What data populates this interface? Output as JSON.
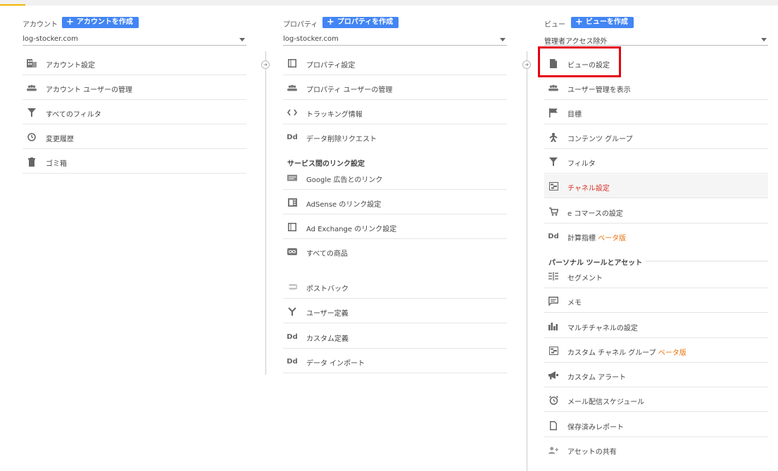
{
  "account": {
    "label": "アカウント",
    "create_label": "アカウントを作成",
    "selected": "log-stocker.com",
    "items": [
      {
        "label": "アカウント設定",
        "icon": "building-icon"
      },
      {
        "label": "アカウント ユーザーの管理",
        "icon": "people-icon"
      },
      {
        "label": "すべてのフィルタ",
        "icon": "filter-icon"
      },
      {
        "label": "変更履歴",
        "icon": "history-icon"
      },
      {
        "label": "ゴミ箱",
        "icon": "trash-icon"
      }
    ]
  },
  "property": {
    "label": "プロパティ",
    "create_label": "プロパティを作成",
    "selected": "log-stocker.com",
    "items": [
      {
        "label": "プロパティ設定",
        "icon": "square-icon"
      },
      {
        "label": "プロパティ ユーザーの管理",
        "icon": "people-icon"
      },
      {
        "label": "トラッキング情報",
        "icon": "code-icon"
      },
      {
        "label": "データ削除リクエスト",
        "icon": "dd-icon"
      }
    ],
    "link_section_title": "サービス間のリンク設定",
    "link_items": [
      {
        "label": "Google 広告とのリンク",
        "icon": "ads-icon"
      },
      {
        "label": "AdSense のリンク設定",
        "icon": "adsense-icon"
      },
      {
        "label": "Ad Exchange のリンク設定",
        "icon": "square-icon"
      },
      {
        "label": "すべての商品",
        "icon": "link-icon"
      }
    ],
    "other_items": [
      {
        "label": "ポストバック",
        "icon": "postback-icon"
      },
      {
        "label": "ユーザー定義",
        "icon": "fork-icon"
      },
      {
        "label": "カスタム定義",
        "icon": "dd-icon"
      },
      {
        "label": "データ インポート",
        "icon": "dd-icon"
      }
    ]
  },
  "view": {
    "label": "ビュー",
    "create_label": "ビューを作成",
    "selected": "管理者アクセス除外",
    "items": [
      {
        "label": "ビューの設定",
        "icon": "document-icon"
      },
      {
        "label": "ユーザー管理を表示",
        "icon": "people-icon"
      },
      {
        "label": "目標",
        "icon": "flag-icon"
      },
      {
        "label": "コンテンツ グループ",
        "icon": "person-walk-icon"
      },
      {
        "label": "フィルタ",
        "icon": "filter-icon"
      },
      {
        "label": "チャネル設定",
        "icon": "channel-icon"
      },
      {
        "label": "e コマースの設定",
        "icon": "cart-icon"
      },
      {
        "label": "計算指標",
        "beta": "ベータ版",
        "icon": "dd-icon"
      }
    ],
    "personal_section_title": "パーソナル ツールとアセット",
    "personal_items": [
      {
        "label": "セグメント",
        "icon": "segment-icon"
      },
      {
        "label": "メモ",
        "icon": "comment-icon"
      },
      {
        "label": "マルチチャネルの設定",
        "icon": "bar-chart-icon"
      },
      {
        "label": "カスタム チャネル グループ",
        "beta": "ベータ版",
        "icon": "channel-icon"
      },
      {
        "label": "カスタム アラート",
        "icon": "megaphone-icon"
      },
      {
        "label": "メール配信スケジュール",
        "icon": "alarm-icon"
      },
      {
        "label": "保存済みレポート",
        "icon": "file-icon"
      },
      {
        "label": "アセットの共有",
        "icon": "person-add-icon"
      }
    ]
  },
  "colors": {
    "accent_blue": "#4285f4",
    "active_red": "#d93025",
    "beta_orange": "#e8710a",
    "highlight_red": "#e60012"
  }
}
